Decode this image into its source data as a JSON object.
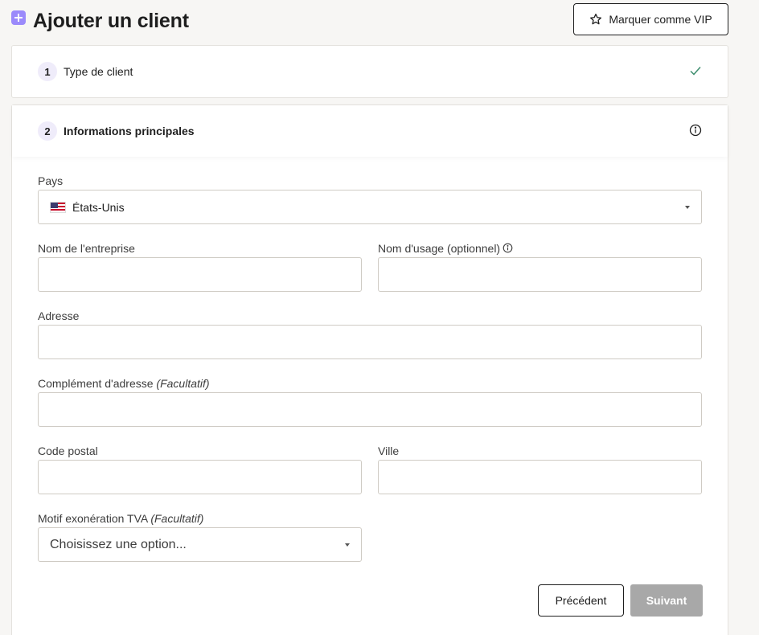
{
  "header": {
    "title": "Ajouter un client",
    "vip_button": "Marquer comme VIP"
  },
  "steps": [
    {
      "number": "1",
      "label": "Type de client",
      "status": "completed"
    },
    {
      "number": "2",
      "label": "Informations principales",
      "status": "active"
    }
  ],
  "form": {
    "country": {
      "label": "Pays",
      "value": "États-Unis"
    },
    "company_name": {
      "label": "Nom de l'entreprise",
      "value": ""
    },
    "usage_name": {
      "label": "Nom d'usage (optionnel)",
      "value": ""
    },
    "address": {
      "label": "Adresse",
      "value": ""
    },
    "address_complement": {
      "label": "Complément d'adresse",
      "optional": "(Facultatif)",
      "value": ""
    },
    "postal_code": {
      "label": "Code postal",
      "value": ""
    },
    "city": {
      "label": "Ville",
      "value": ""
    },
    "vat_exemption": {
      "label": "Motif exonération TVA",
      "optional": "(Facultatif)",
      "placeholder": "Choisissez une option..."
    }
  },
  "actions": {
    "previous": "Précédent",
    "next": "Suivant"
  },
  "icons": {
    "add": "add-square-icon",
    "star": "star-icon",
    "check": "check-icon",
    "info": "info-icon",
    "flag": "us-flag-icon",
    "caret": "caret-down-icon"
  },
  "colors": {
    "accent": "#9b8afb",
    "check": "#3f8f6f",
    "disabled_button": "#a8a8a8"
  }
}
